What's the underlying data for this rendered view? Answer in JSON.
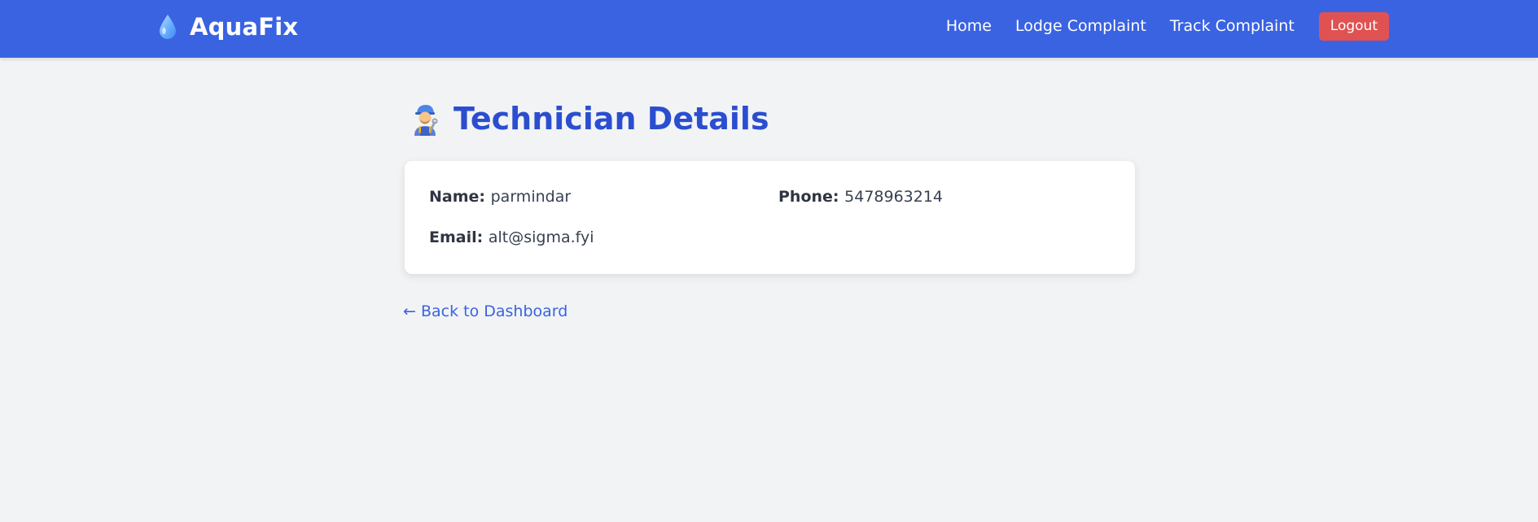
{
  "navbar": {
    "brand_icon": "water-drop-icon",
    "brand_name": "AquaFix",
    "links": [
      {
        "label": "Home"
      },
      {
        "label": "Lodge Complaint"
      },
      {
        "label": "Track Complaint"
      }
    ],
    "logout_label": "Logout",
    "colors": {
      "background": "#3a63e2",
      "logout": "#e05252"
    }
  },
  "page": {
    "title_icon": "technician-icon",
    "title": "Technician Details",
    "title_color": "#2b4ed0"
  },
  "technician": {
    "name_label": "Name:",
    "name": "parmindar",
    "phone_label": "Phone:",
    "phone": "5478963214",
    "email_label": "Email:",
    "email": "alt@sigma.fyi"
  },
  "back_link": "← Back to Dashboard"
}
